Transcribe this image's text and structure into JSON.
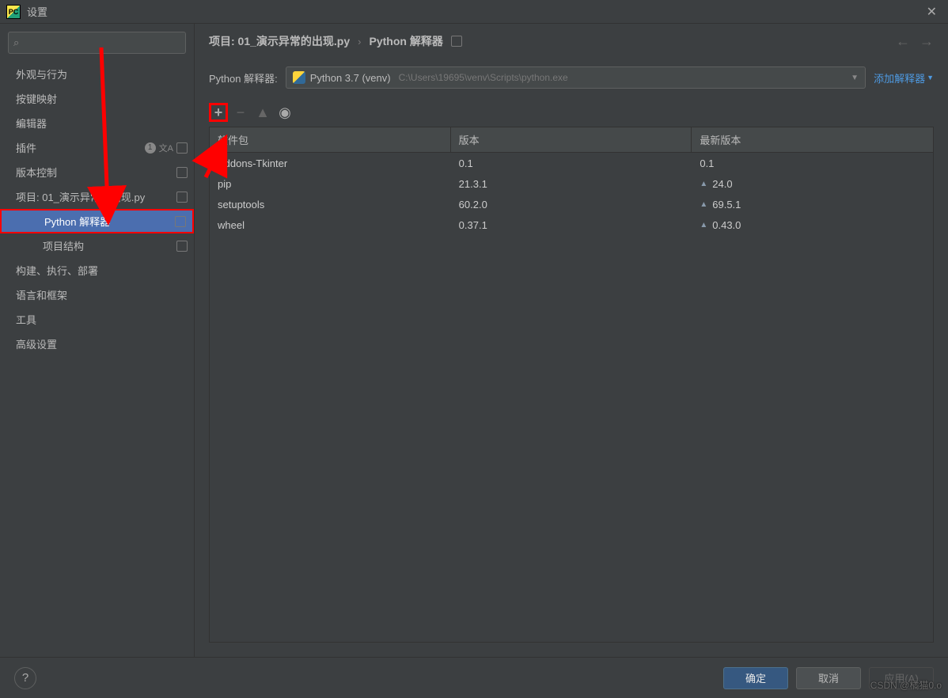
{
  "title": "设置",
  "search": {
    "placeholder": ""
  },
  "sidebar": {
    "items": [
      {
        "label": "外观与行为",
        "expandable": true,
        "expanded": false
      },
      {
        "label": "按键映射",
        "expandable": false
      },
      {
        "label": "编辑器",
        "expandable": true,
        "expanded": false
      },
      {
        "label": "插件",
        "expandable": false,
        "badges": true
      },
      {
        "label": "版本控制",
        "expandable": true,
        "expanded": false,
        "icon": true
      },
      {
        "label": "项目: 01_演示异常的出现.py",
        "expandable": true,
        "expanded": true,
        "icon": true
      },
      {
        "label": "Python 解释器",
        "level": 2,
        "selected": true,
        "icon": true
      },
      {
        "label": "项目结构",
        "level": 2,
        "icon": true
      },
      {
        "label": "构建、执行、部署",
        "expandable": true,
        "expanded": false
      },
      {
        "label": "语言和框架",
        "expandable": true,
        "expanded": false
      },
      {
        "label": "工具",
        "expandable": true,
        "expanded": false
      },
      {
        "label": "高级设置",
        "expandable": false
      }
    ]
  },
  "breadcrumb": {
    "crumb1": "项目: 01_演示异常的出现.py",
    "crumb2": "Python 解释器"
  },
  "interpreter": {
    "label": "Python 解释器:",
    "name": "Python 3.7 (venv)",
    "path": "C:\\Users\\19695\\venv\\Scripts\\python.exe",
    "add_link": "添加解释器"
  },
  "packages": {
    "headers": {
      "name": "软件包",
      "version": "版本",
      "latest": "最新版本"
    },
    "rows": [
      {
        "name": "Addons-Tkinter",
        "version": "0.1",
        "latest": "0.1",
        "upgrade": false
      },
      {
        "name": "pip",
        "version": "21.3.1",
        "latest": "24.0",
        "upgrade": true
      },
      {
        "name": "setuptools",
        "version": "60.2.0",
        "latest": "69.5.1",
        "upgrade": true
      },
      {
        "name": "wheel",
        "version": "0.37.1",
        "latest": "0.43.0",
        "upgrade": true
      }
    ]
  },
  "footer": {
    "ok": "确定",
    "cancel": "取消",
    "apply": "应用(A)"
  },
  "watermark": "CSDN @橘猫0.o"
}
